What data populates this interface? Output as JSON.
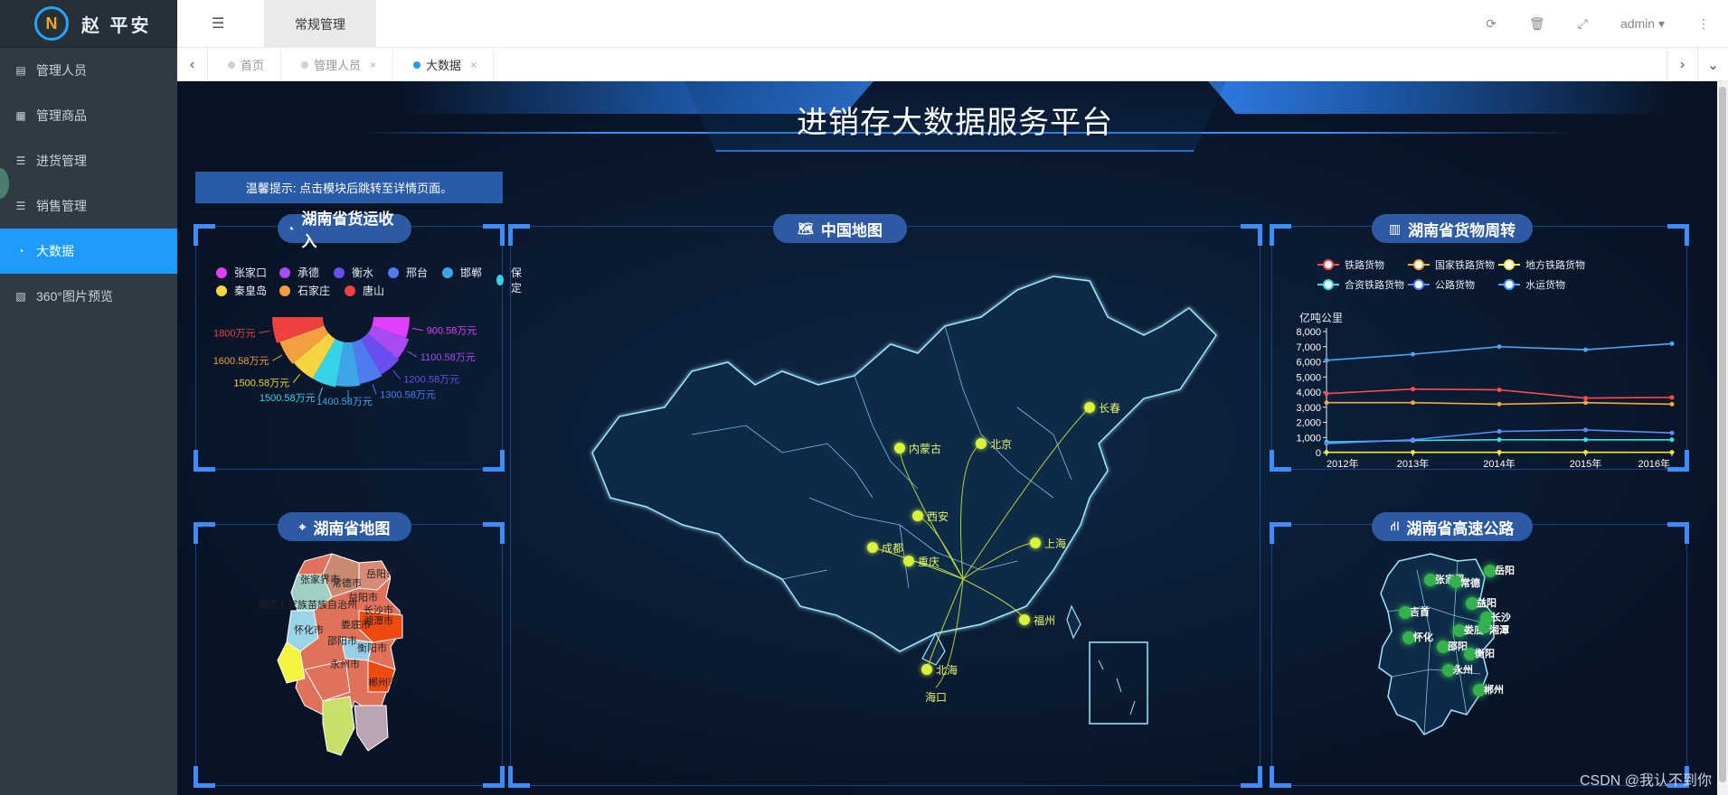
{
  "app": {
    "logo_mark": "N",
    "name": "赵 平安"
  },
  "sidebar": {
    "items": [
      {
        "label": "管理人员",
        "icon": "▤"
      },
      {
        "label": "管理商品",
        "icon": "▦"
      },
      {
        "label": "进货管理",
        "icon": "☰"
      },
      {
        "label": "销售管理",
        "icon": "☰"
      },
      {
        "label": "大数据",
        "icon": "◔"
      },
      {
        "label": "360°图片预览",
        "icon": "▧"
      }
    ]
  },
  "topbar": {
    "tab": "常规管理",
    "fold_icon": "☰",
    "refresh_icon": "⟳",
    "delete_icon": "🗑",
    "fullscreen_icon": "⤢",
    "user": "admin ▾",
    "more_icon": "⋮"
  },
  "tabs": {
    "left_arrow": "‹",
    "right_arrow": "›",
    "down_arrow": "⌄",
    "close": "×",
    "items": [
      {
        "label": "首页"
      },
      {
        "label": "管理人员"
      },
      {
        "label": "大数据"
      }
    ]
  },
  "dashboard": {
    "title": "进销存大数据服务平台",
    "tip": "温馨提示: 点击模块后跳转至详情页面。",
    "panels": {
      "freight": {
        "title": "湖南省货运收入",
        "icon": "◔"
      },
      "hunan_map": {
        "title": "湖南省地图",
        "icon": "⌖"
      },
      "china_map": {
        "title": "中国地图",
        "icon": "🗺"
      },
      "turnover": {
        "title": "湖南省货物周转",
        "icon": "▥"
      },
      "highway": {
        "title": "湖南省高速公路",
        "icon": "⛙"
      }
    },
    "watermark": "CSDN @我认不到你"
  },
  "freight_legend": [
    {
      "name": "张家口",
      "color": "#e040fb"
    },
    {
      "name": "承德",
      "color": "#a64cf0"
    },
    {
      "name": "衡水",
      "color": "#6a4ef0"
    },
    {
      "name": "邢台",
      "color": "#4f7bf0"
    },
    {
      "name": "邯郸",
      "color": "#3ba5e8"
    },
    {
      "name": "保定",
      "color": "#36d3e8"
    },
    {
      "name": "秦皇岛",
      "color": "#f5d442"
    },
    {
      "name": "石家庄",
      "color": "#f5a040"
    },
    {
      "name": "唐山",
      "color": "#f04040"
    }
  ],
  "china_cities": [
    "长春",
    "北京",
    "内蒙古",
    "西安",
    "成都",
    "重庆",
    "上海",
    "福州",
    "北海",
    "海口"
  ],
  "hunan_cities": [
    "张家界市",
    "常德市",
    "岳阳市",
    "益阳市",
    "湘西土家族苗族自治州",
    "长沙市",
    "怀化市",
    "娄底市",
    "湘潭市",
    "邵阳市",
    "衡阳市",
    "永州市",
    "郴州市"
  ],
  "highway_cities": [
    "张家界",
    "常德",
    "岳阳",
    "吉首",
    "益阳",
    "长沙",
    "怀化",
    "娄底",
    "湘潭",
    "邵阳",
    "衡阳",
    "永州",
    "郴州"
  ],
  "chart_data": [
    {
      "type": "pie",
      "title": "湖南省货运收入",
      "categories": [
        "张家口",
        "承德",
        "衡水",
        "邢台",
        "邯郸",
        "保定",
        "秦皇岛",
        "石家庄",
        "唐山"
      ],
      "values": [
        900.58,
        1100.58,
        1200.58,
        1300.58,
        1400.58,
        1500.58,
        1500.58,
        1600.58,
        1800
      ],
      "labels": [
        "900.58万元",
        "1100.58万元",
        "1200.58万元",
        "1300.58万元",
        "1400.58万元",
        "1500.58万元",
        "1500.58万元",
        "1600.58万元",
        "1800万元"
      ],
      "legend": "top"
    },
    {
      "type": "line",
      "title": "湖南省货物周转",
      "ylabel": "亿吨公里",
      "x": [
        "2012年",
        "2013年",
        "2014年",
        "2015年",
        "2016年"
      ],
      "ylim": [
        0,
        8000
      ],
      "yticks": [
        "8,000",
        "7,000",
        "6,000",
        "5,000",
        "4,000",
        "3,000",
        "2,000",
        "1,000",
        "0"
      ],
      "legend": "top",
      "series": [
        {
          "name": "铁路货物",
          "color": "#ff4d4f",
          "values": [
            3900,
            4200,
            4150,
            3600,
            3650
          ]
        },
        {
          "name": "国家铁路货物",
          "color": "#f5a742",
          "values": [
            3300,
            3300,
            3200,
            3300,
            3200
          ]
        },
        {
          "name": "地方铁路货物",
          "color": "#f5e642",
          "values": [
            20,
            20,
            20,
            20,
            20
          ]
        },
        {
          "name": "合资铁路货物",
          "color": "#36e2e8",
          "values": [
            700,
            800,
            850,
            850,
            850
          ]
        },
        {
          "name": "公路货物",
          "color": "#5b8cff",
          "values": [
            600,
            850,
            1400,
            1500,
            1300
          ]
        },
        {
          "name": "水运货物",
          "color": "#4aa8ff",
          "values": [
            6100,
            6500,
            7000,
            6800,
            7200
          ]
        }
      ]
    }
  ]
}
